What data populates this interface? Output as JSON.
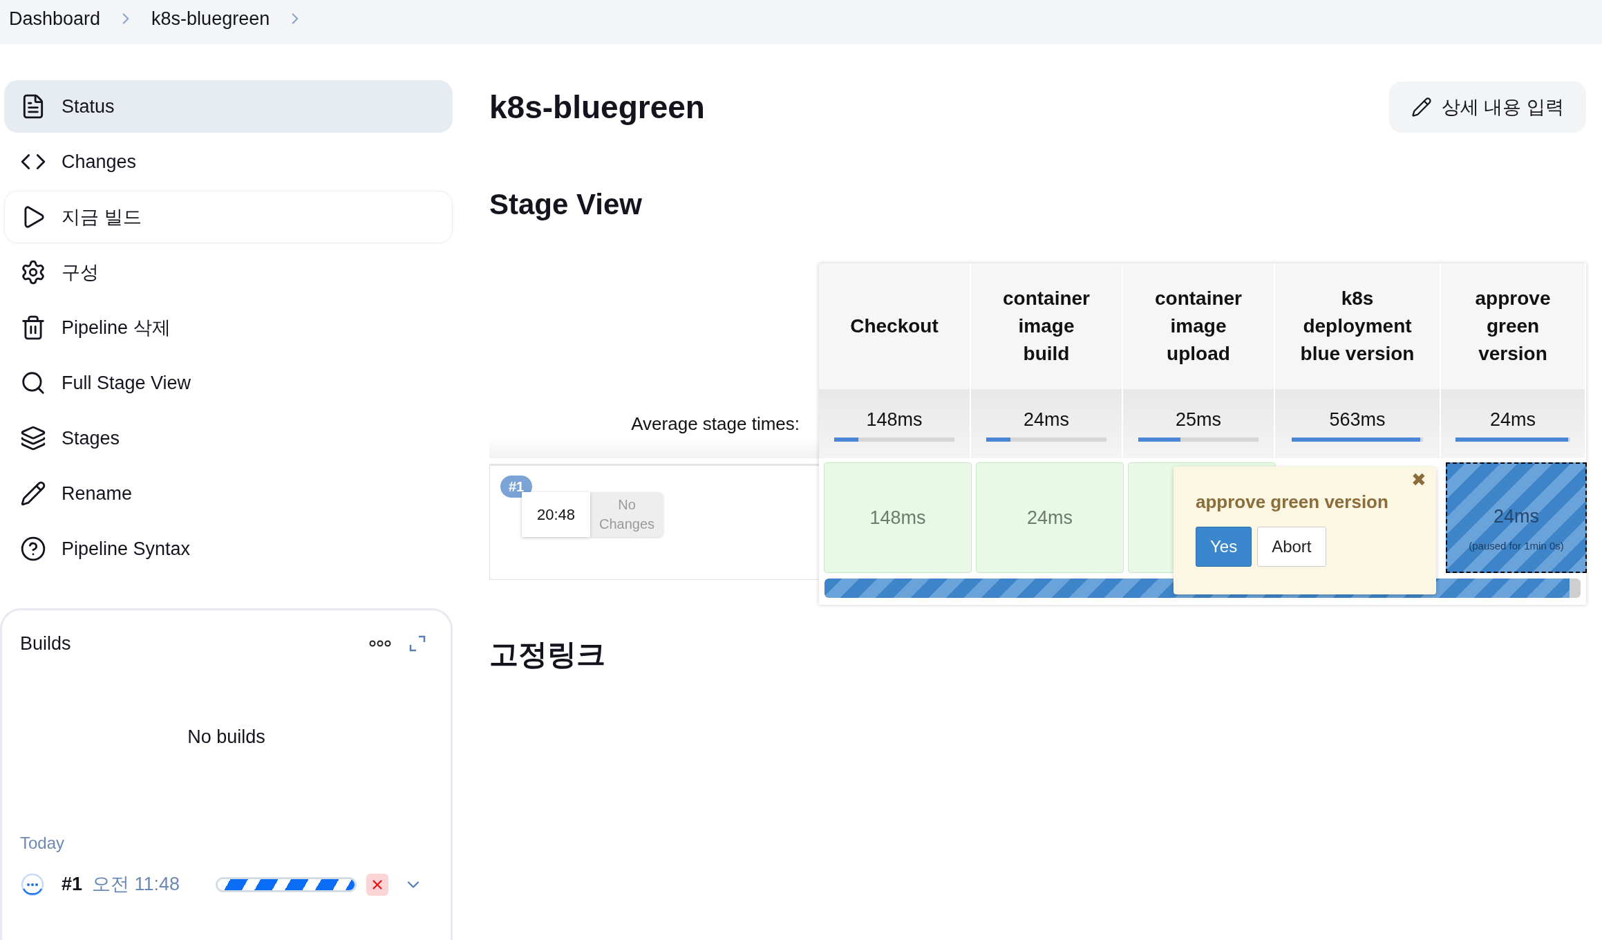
{
  "breadcrumbs": [
    {
      "label": "Dashboard"
    },
    {
      "label": "k8s-bluegreen"
    }
  ],
  "sidebar": {
    "items": [
      {
        "label": "Status",
        "selected": true,
        "focused": false
      },
      {
        "label": "Changes",
        "selected": false,
        "focused": false
      },
      {
        "label": "지금 빌드",
        "selected": false,
        "focused": true
      },
      {
        "label": "구성",
        "selected": false,
        "focused": false
      },
      {
        "label": "Pipeline 삭제",
        "selected": false,
        "focused": false
      },
      {
        "label": "Full Stage View",
        "selected": false,
        "focused": false
      },
      {
        "label": "Stages",
        "selected": false,
        "focused": false
      },
      {
        "label": "Rename",
        "selected": false,
        "focused": false
      },
      {
        "label": "Pipeline Syntax",
        "selected": false,
        "focused": false
      }
    ]
  },
  "builds_panel": {
    "title": "Builds",
    "empty_text": "No builds",
    "group_label": "Today",
    "builds": [
      {
        "number": "#1",
        "time": "오전 11:48",
        "in_progress": true,
        "level": 1
      }
    ]
  },
  "page": {
    "title": "k8s-bluegreen",
    "edit_button": "상세 내용 입력"
  },
  "stage_view": {
    "title": "Stage View",
    "average_label": "Average stage times:",
    "stages": [
      {
        "name": "Checkout",
        "average": "148ms",
        "level": 0.2
      },
      {
        "name": "container image build",
        "average": "24ms",
        "level": 0.2
      },
      {
        "name": "container image upload",
        "average": "25ms",
        "level": 0.35
      },
      {
        "name": "k8s deployment blue version",
        "average": "563ms",
        "level": 0.98
      },
      {
        "name": "approve green version",
        "average": "24ms",
        "level": 0.98
      }
    ],
    "run": {
      "badge": "#1",
      "time": "20:48",
      "changes": "No Changes",
      "level": 0.985,
      "cells": [
        {
          "kind": "success",
          "time": "148ms"
        },
        {
          "kind": "success",
          "time": "24ms"
        },
        {
          "kind": "success"
        },
        {
          "kind": "covered"
        },
        {
          "kind": "paused",
          "time": "24ms",
          "note": "(paused for 1min 0s)"
        }
      ]
    },
    "approval": {
      "title": "approve green version",
      "close": "✖",
      "buttons": [
        {
          "label": "Yes",
          "kind": "primary"
        },
        {
          "label": "Abort",
          "kind": "default"
        }
      ]
    }
  },
  "permalinks": {
    "title": "고정링크"
  }
}
